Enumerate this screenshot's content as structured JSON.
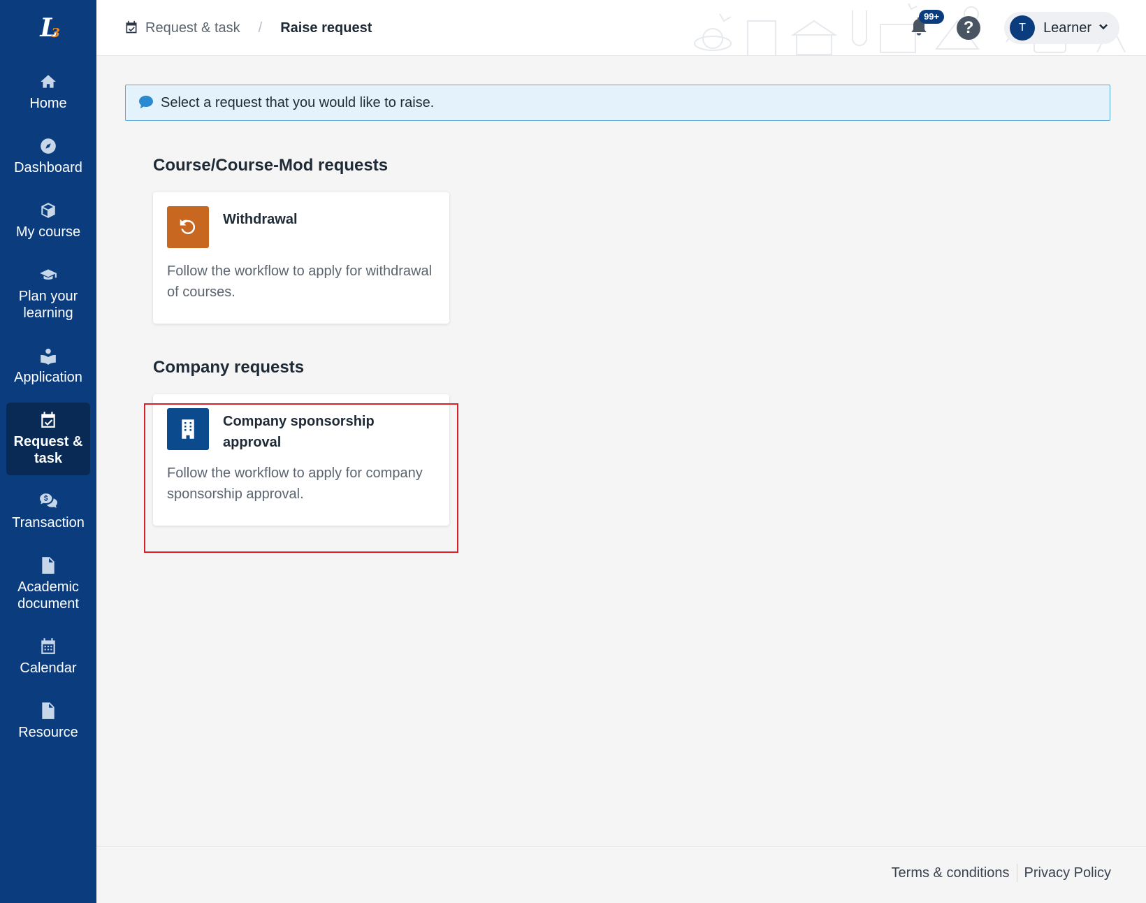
{
  "sidebar": {
    "logo_text": "L",
    "items": [
      {
        "label": "Home",
        "icon": "home-icon",
        "active": false
      },
      {
        "label": "Dashboard",
        "icon": "compass-icon",
        "active": false
      },
      {
        "label": "My course",
        "icon": "box-icon",
        "active": false
      },
      {
        "label": "Plan your learning",
        "icon": "graduation-cap-icon",
        "active": false
      },
      {
        "label": "Application",
        "icon": "reader-icon",
        "active": false
      },
      {
        "label": "Request & task",
        "icon": "calendar-check-icon",
        "active": true
      },
      {
        "label": "Transaction",
        "icon": "chat-dollar-icon",
        "active": false
      },
      {
        "label": "Academic document",
        "icon": "pdf-file-icon",
        "active": false
      },
      {
        "label": "Calendar",
        "icon": "calendar-icon",
        "active": false
      },
      {
        "label": "Resource",
        "icon": "file-icon",
        "active": false
      }
    ]
  },
  "header": {
    "breadcrumb": {
      "parent": "Request & task",
      "separator": "/",
      "current": "Raise request"
    },
    "notifications_badge": "99+",
    "help_label": "?",
    "user": {
      "initial": "T",
      "name": "Learner"
    }
  },
  "main": {
    "info_message": "Select a request that you would like to raise.",
    "sections": [
      {
        "title": "Course/Course-Mod requests",
        "cards": [
          {
            "title": "Withdrawal",
            "description": "Follow the workflow to apply for withdrawal of courses.",
            "icon": "undo-icon",
            "color": "#c8671f"
          }
        ]
      },
      {
        "title": "Company requests",
        "cards": [
          {
            "title": "Company sponsorship approval",
            "description": "Follow the workflow to apply for company sponsorship approval.",
            "icon": "building-icon",
            "color": "#0b4a8c"
          }
        ]
      }
    ]
  },
  "footer": {
    "links": [
      "Terms & conditions",
      "Privacy Policy"
    ]
  },
  "colors": {
    "sidebar": "#0b3d7e",
    "highlight": "#d9212c",
    "info_bg": "#e4f2fb"
  }
}
